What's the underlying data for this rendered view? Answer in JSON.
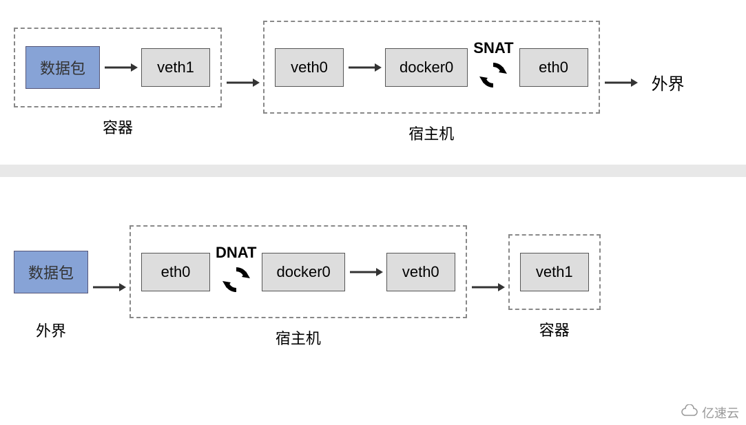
{
  "chart_data": [
    {
      "type": "diagram",
      "title": "Outbound (SNAT) path",
      "flow": [
        "数据包",
        "veth1",
        "veth0",
        "docker0",
        "SNAT",
        "eth0",
        "外界"
      ],
      "groups": [
        {
          "label": "容器",
          "nodes": [
            "数据包",
            "veth1"
          ]
        },
        {
          "label": "宿主机",
          "nodes": [
            "veth0",
            "docker0",
            "SNAT",
            "eth0"
          ]
        }
      ],
      "external_label": "外界"
    },
    {
      "type": "diagram",
      "title": "Inbound (DNAT) path",
      "flow": [
        "数据包",
        "eth0",
        "DNAT",
        "docker0",
        "veth0",
        "veth1"
      ],
      "groups": [
        {
          "label": "外界",
          "nodes": [
            "数据包"
          ]
        },
        {
          "label": "宿主机",
          "nodes": [
            "eth0",
            "DNAT",
            "docker0",
            "veth0"
          ]
        },
        {
          "label": "容器",
          "nodes": [
            "veth1"
          ]
        }
      ]
    }
  ],
  "d1": {
    "packet": "数据包",
    "veth1": "veth1",
    "veth0": "veth0",
    "docker0": "docker0",
    "snat": "SNAT",
    "eth0": "eth0",
    "external": "外界",
    "container_label": "容器",
    "host_label": "宿主机"
  },
  "d2": {
    "packet": "数据包",
    "eth0": "eth0",
    "dnat": "DNAT",
    "docker0": "docker0",
    "veth0": "veth0",
    "veth1": "veth1",
    "external_label": "外界",
    "host_label": "宿主机",
    "container_label": "容器"
  },
  "watermark": "亿速云"
}
